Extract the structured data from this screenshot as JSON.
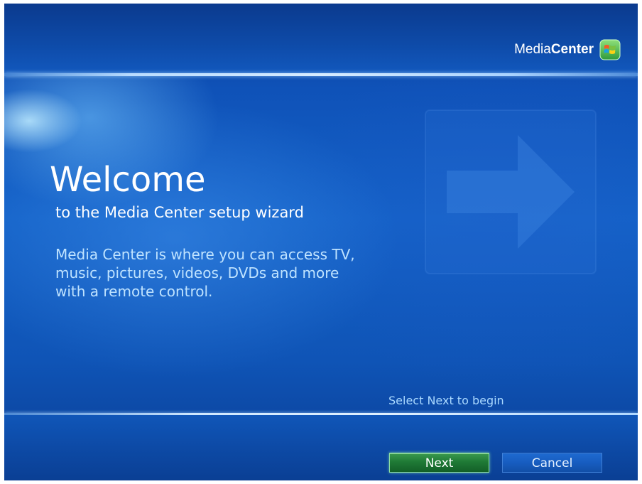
{
  "header": {
    "logo_text_light": "Media",
    "logo_text_bold": "Center",
    "logo_icon": "windows-flag-icon"
  },
  "main": {
    "title": "Welcome",
    "subtitle": "to the Media Center setup wizard",
    "description": "Media Center is where you can access TV, music, pictures, videos, DVDs and more with a remote control.",
    "watermark_icon": "arrow-right-icon"
  },
  "footer": {
    "hint": "Select Next to begin",
    "next_label": "Next",
    "cancel_label": "Cancel"
  },
  "colors": {
    "background": "#1462c8",
    "accent_line": "#d7ecff",
    "next_button": "#1f7a36",
    "cancel_button": "#175dc0",
    "description_text": "#bfe3ff"
  }
}
